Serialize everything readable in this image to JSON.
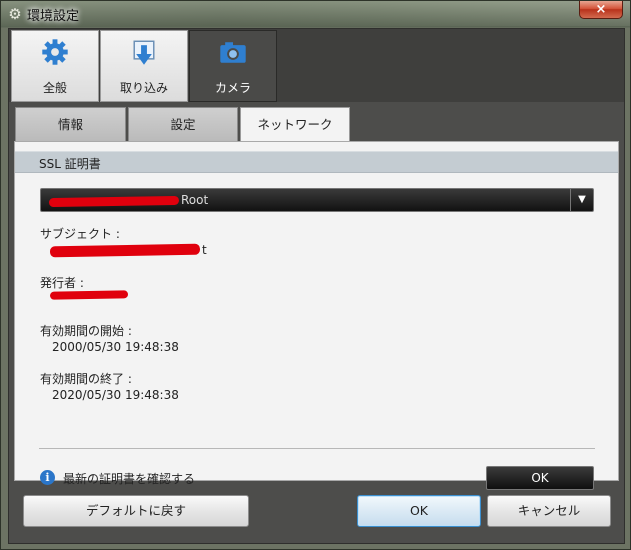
{
  "window": {
    "title": "環境設定",
    "close_label": "×"
  },
  "top_tabs": [
    {
      "label": "全般",
      "icon": "gear-icon"
    },
    {
      "label": "取り込み",
      "icon": "import-icon"
    },
    {
      "label": "カメラ",
      "icon": "camera-icon",
      "active": true
    }
  ],
  "sub_tabs": [
    {
      "label": "情報"
    },
    {
      "label": "設定"
    },
    {
      "label": "ネットワーク",
      "active": true
    }
  ],
  "ssl": {
    "section_title": "SSL 証明書",
    "selected_certificate": "Root",
    "subject_label": "サブジェクト :",
    "subject_value": "t",
    "issuer_label": "発行者 :",
    "valid_from_label": "有効期間の開始 :",
    "valid_from_value": "2000/05/30 19:48:38",
    "valid_to_label": "有効期間の終了 :",
    "valid_to_value": "2020/05/30 19:48:38",
    "check_latest_text": "最新の証明書を確認する",
    "ok_label": "OK"
  },
  "footer": {
    "default_label": "デフォルトに戻す",
    "ok_label": "OK",
    "cancel_label": "キャンセル"
  },
  "colors": {
    "accent_blue": "#2b76c9",
    "redaction_red": "#e0000d",
    "close_red": "#c8432a"
  }
}
